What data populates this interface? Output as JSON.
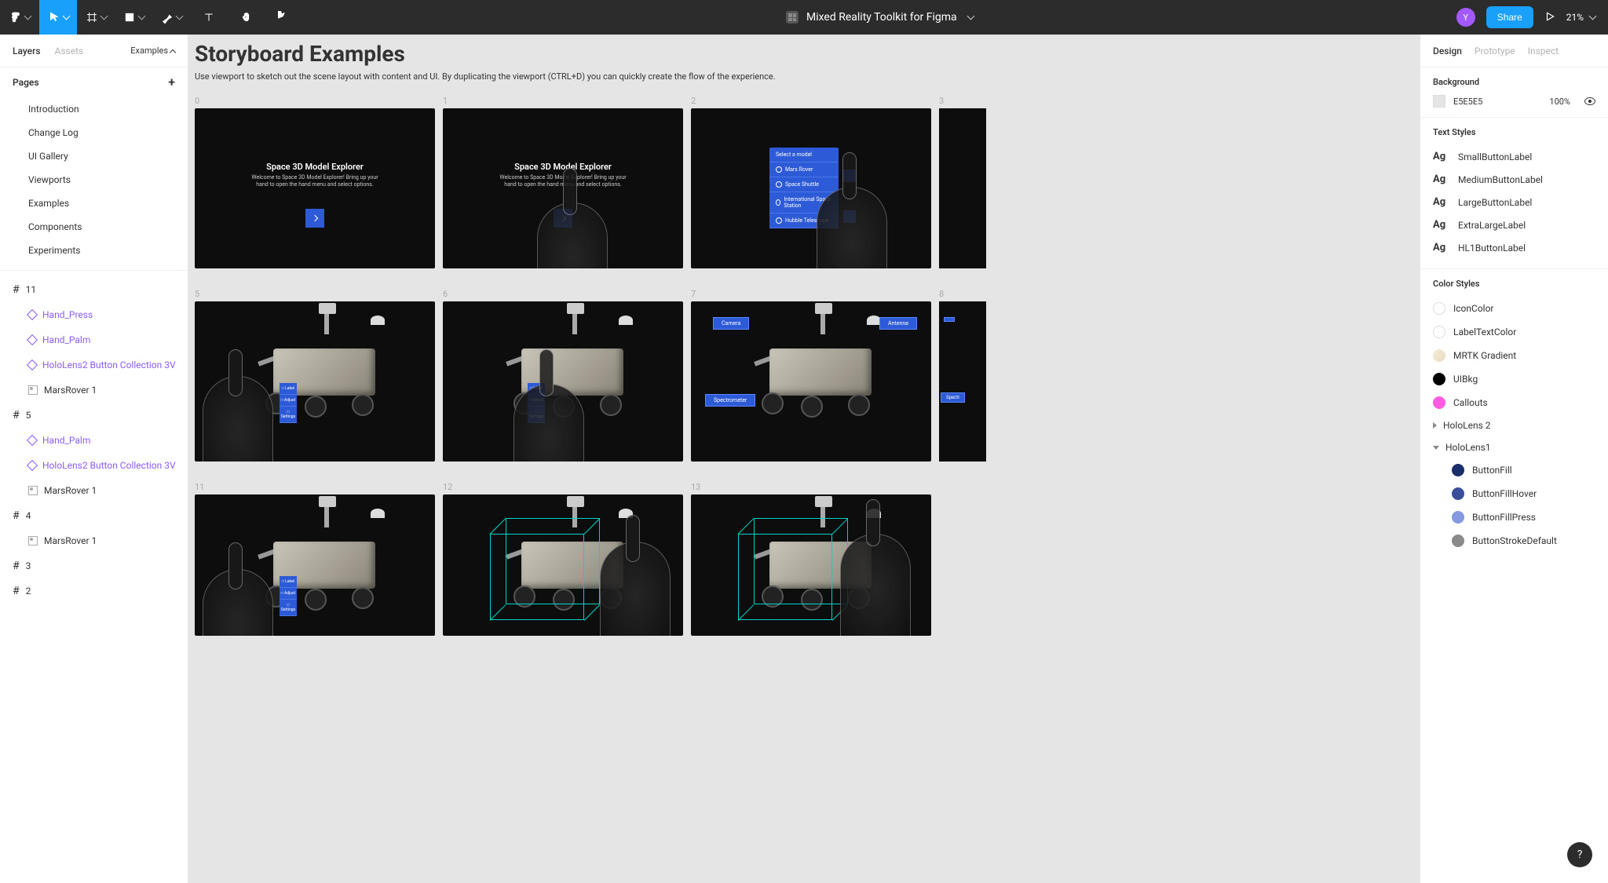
{
  "header": {
    "title": "Mixed Reality Toolkit for Figma",
    "share_label": "Share",
    "avatar_initial": "Y",
    "zoom_label": "21%"
  },
  "left_panel": {
    "tabs": {
      "layers": "Layers",
      "assets": "Assets"
    },
    "page_selector": "Examples",
    "pages_header": "Pages",
    "pages": [
      {
        "label": "Introduction"
      },
      {
        "label": "Change Log"
      },
      {
        "label": "UI Gallery"
      },
      {
        "label": "Viewports"
      },
      {
        "label": "Examples",
        "selected": true
      },
      {
        "label": "Components"
      },
      {
        "label": "Experiments"
      }
    ],
    "layers": [
      {
        "kind": "frame",
        "label": "11"
      },
      {
        "kind": "component",
        "label": "Hand_Press",
        "purple": true,
        "indent": 1
      },
      {
        "kind": "component",
        "label": "Hand_Palm",
        "purple": true,
        "indent": 1
      },
      {
        "kind": "component",
        "label": "HoloLens2 Button Collection 3V",
        "purple": true,
        "indent": 1
      },
      {
        "kind": "image",
        "label": "MarsRover 1",
        "indent": 1
      },
      {
        "kind": "frame",
        "label": "5"
      },
      {
        "kind": "component",
        "label": "Hand_Palm",
        "purple": true,
        "indent": 1
      },
      {
        "kind": "component",
        "label": "HoloLens2 Button Collection 3V",
        "purple": true,
        "indent": 1
      },
      {
        "kind": "image",
        "label": "MarsRover 1",
        "indent": 1
      },
      {
        "kind": "frame",
        "label": "4"
      },
      {
        "kind": "image",
        "label": "MarsRover 1",
        "indent": 1
      },
      {
        "kind": "frame",
        "label": "3"
      },
      {
        "kind": "frame",
        "label": "2"
      }
    ]
  },
  "canvas": {
    "title": "Storyboard Examples",
    "subtitle": "Use viewport to sketch out the scene layout with content and UI. By duplicating the viewport (CTRL+D) you can quickly create the flow of the experience.",
    "rows": [
      {
        "cells": [
          {
            "label": "0",
            "type": "intro"
          },
          {
            "label": "1",
            "type": "intro_hand"
          },
          {
            "label": "2",
            "type": "menu_select"
          },
          {
            "label": "3",
            "type": "peek"
          }
        ]
      },
      {
        "cells": [
          {
            "label": "5",
            "type": "rover_palm"
          },
          {
            "label": "6",
            "type": "rover_press"
          },
          {
            "label": "7",
            "type": "rover_callouts"
          },
          {
            "label": "8",
            "type": "peek_callout"
          }
        ]
      },
      {
        "cells": [
          {
            "label": "11",
            "type": "rover_palm",
            "tall": true
          },
          {
            "label": "12",
            "type": "rover_cube_reach",
            "tall": true
          },
          {
            "label": "13",
            "type": "rover_cube_grab",
            "tall": true
          }
        ]
      }
    ],
    "board_text": {
      "intro_title": "Space 3D Model Explorer",
      "intro_sub": "Welcome to Space 3D Model Explorer! Bring up your hand to open the hand menu and select options.",
      "select_model": "Select a model",
      "menu_items": [
        "Mars Rover",
        "Space Shuttle",
        "International Space Station",
        "Hubble Telescope"
      ],
      "callout_camera": "Camera",
      "callout_antenna": "Antenna",
      "callout_spectrometer": "Spectrometer",
      "sidemenu": [
        "Label",
        "Adjust",
        "Settings"
      ]
    }
  },
  "right_panel": {
    "tabs": {
      "design": "Design",
      "prototype": "Prototype",
      "inspect": "Inspect"
    },
    "background": {
      "title": "Background",
      "hex": "E5E5E5",
      "opacity": "100%"
    },
    "text_styles": {
      "title": "Text Styles",
      "items": [
        "SmallButtonLabel",
        "MediumButtonLabel",
        "LargeButtonLabel",
        "ExtraLargeLabel",
        "HL1ButtonLabel"
      ]
    },
    "color_styles": {
      "title": "Color Styles",
      "items": [
        {
          "label": "IconColor",
          "sw": "csw-white"
        },
        {
          "label": "LabelTextColor",
          "sw": "csw-white"
        },
        {
          "label": "MRTK Gradient",
          "sw": "csw-grad"
        },
        {
          "label": "UIBkg",
          "sw": "csw-black"
        },
        {
          "label": "Callouts",
          "sw": "csw-pink"
        }
      ],
      "folders": [
        {
          "label": "HoloLens 2",
          "open": false
        },
        {
          "label": "HoloLens1",
          "open": true,
          "children": [
            {
              "label": "ButtonFill",
              "sw": "csw-buttonfill"
            },
            {
              "label": "ButtonFillHover",
              "sw": "csw-buttonfillhover"
            },
            {
              "label": "ButtonFillPress",
              "sw": "csw-buttonfillpress"
            },
            {
              "label": "ButtonStrokeDefault",
              "sw": "csw-buttonstroke"
            }
          ]
        }
      ]
    }
  },
  "help_label": "?"
}
